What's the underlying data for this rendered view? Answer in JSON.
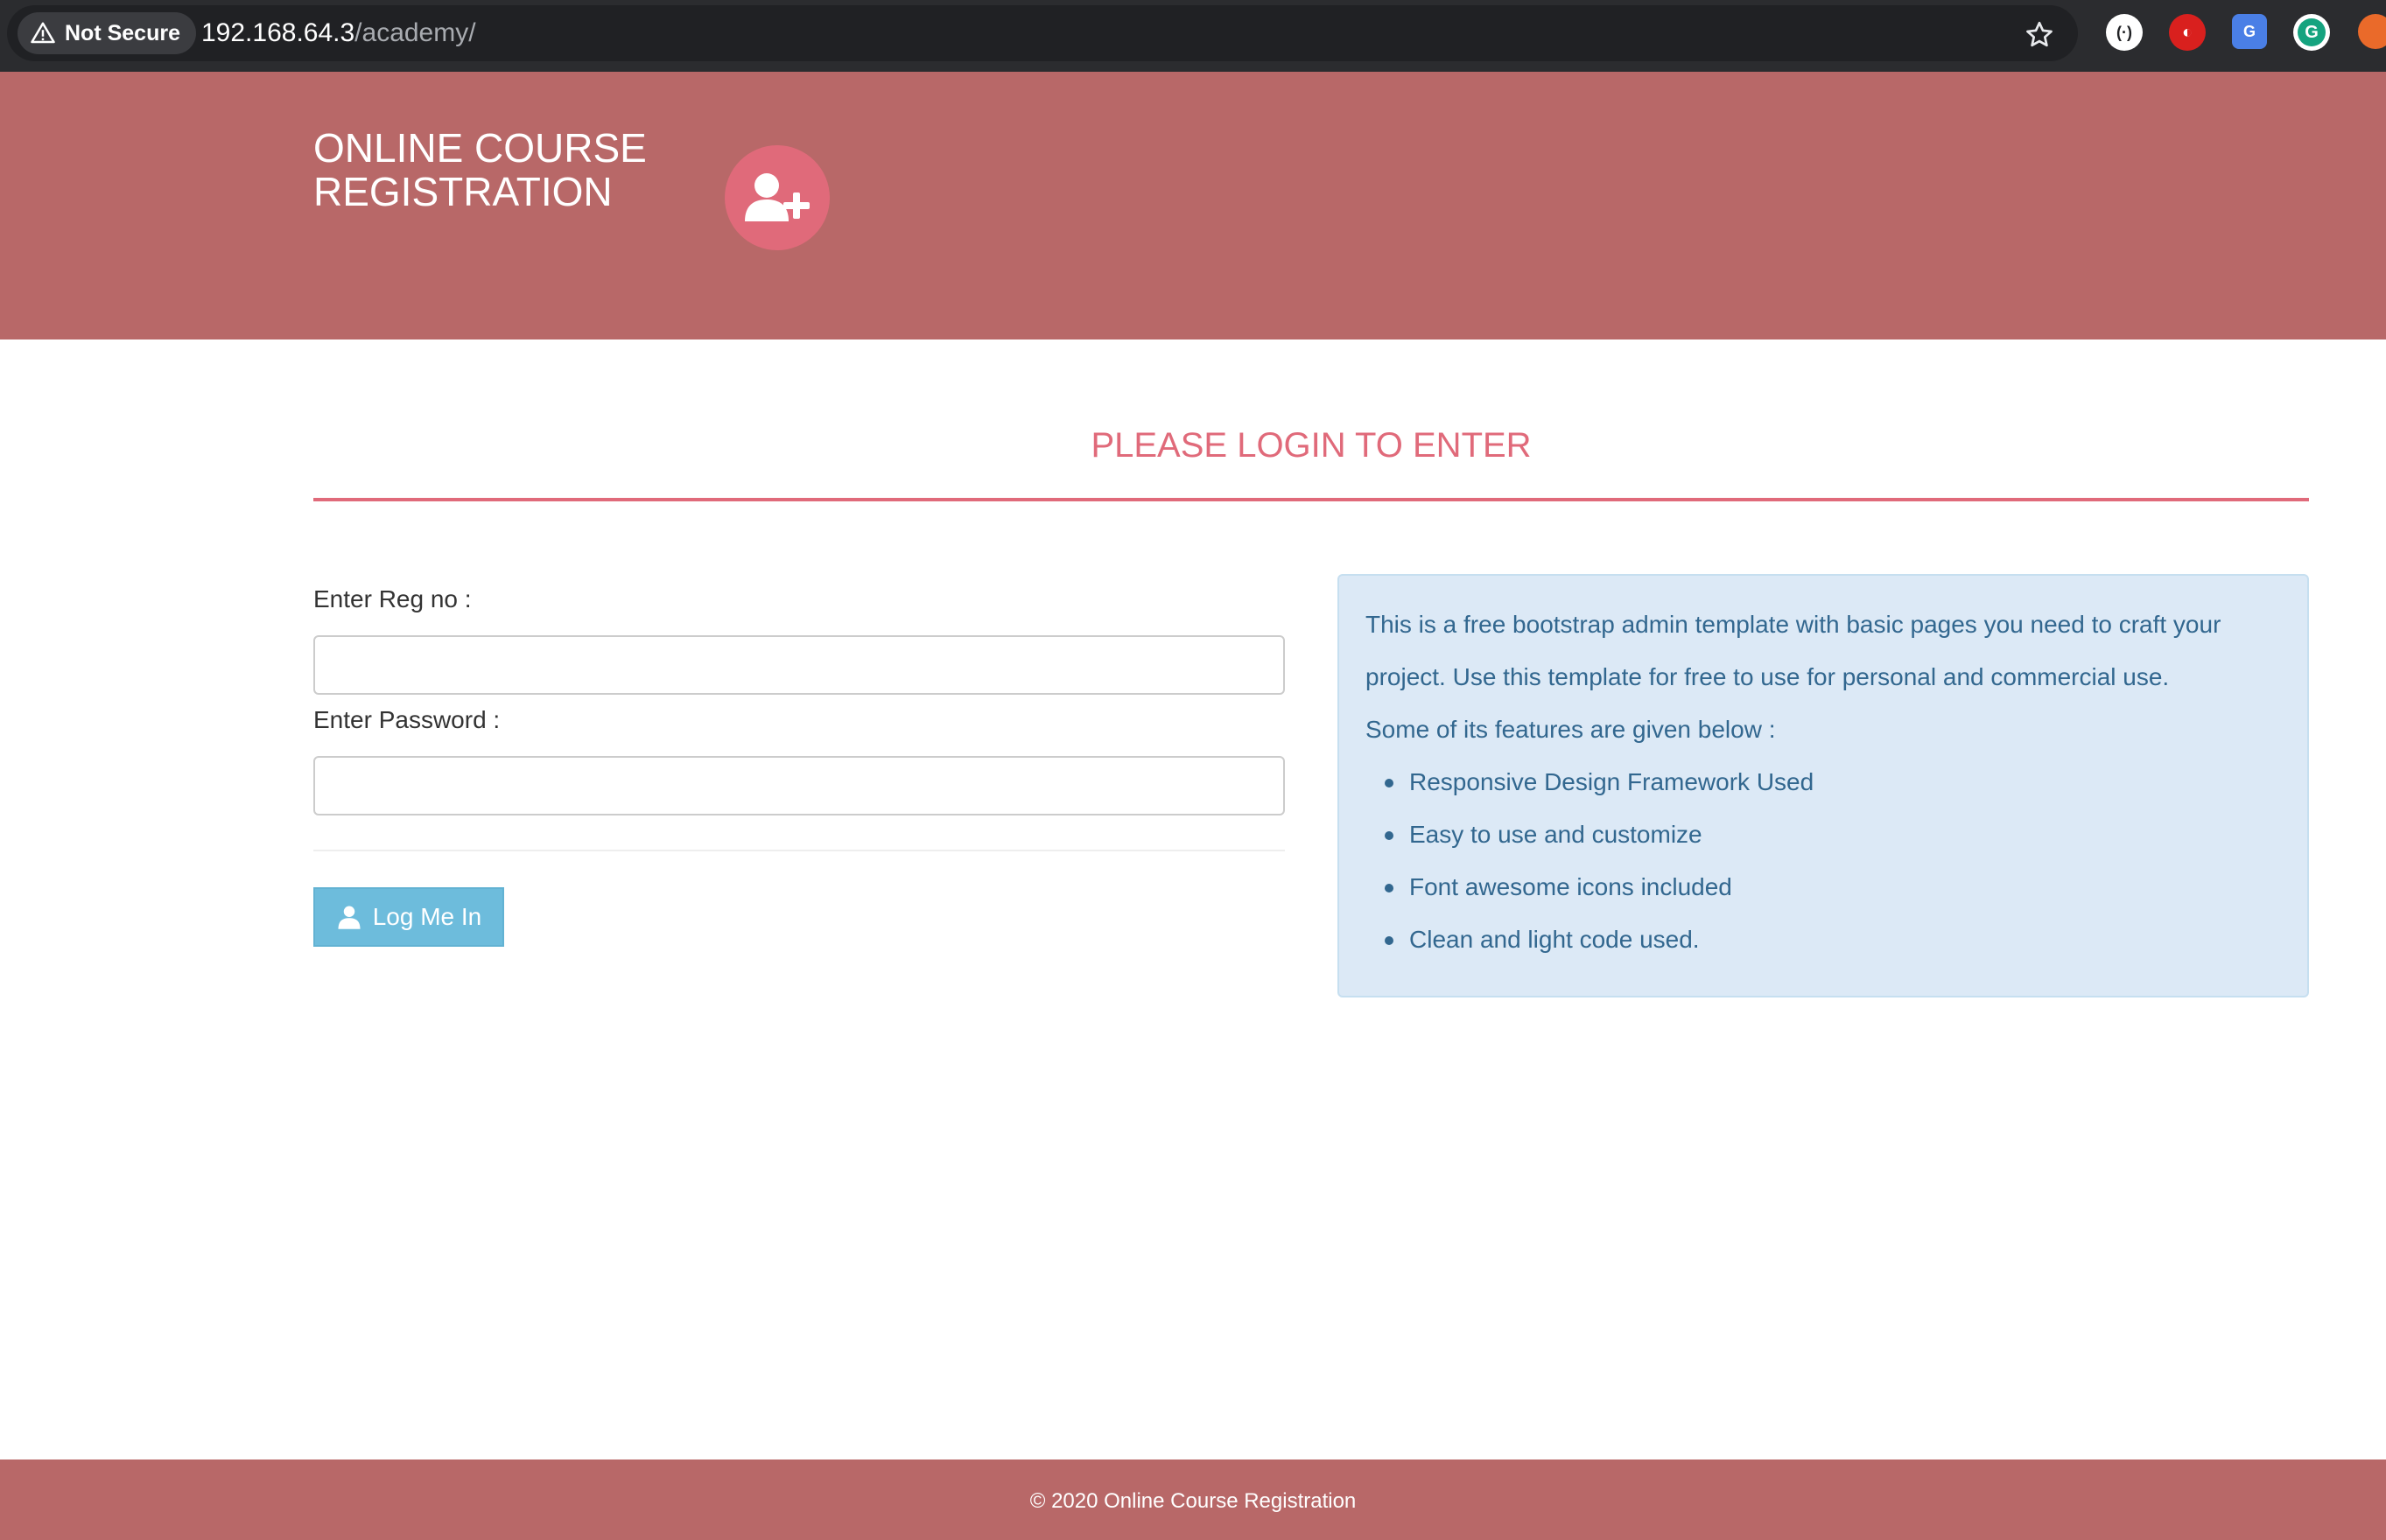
{
  "browser": {
    "security_label": "Not Secure",
    "url_host": "192.168.64.3",
    "url_path": "/academy/",
    "icons": [
      "warning-triangle-icon",
      "star-icon",
      "extension-icons"
    ]
  },
  "header": {
    "title": "ONLINE COURSE REGISTRATION",
    "logo_icon": "user-plus-icon"
  },
  "main": {
    "heading": "PLEASE LOGIN TO ENTER",
    "form": {
      "reg_label": "Enter Reg no :",
      "reg_value": "",
      "password_label": "Enter Password :",
      "password_value": "",
      "submit_label": "Log Me In",
      "submit_icon": "user-icon"
    },
    "info": {
      "intro": "This is a free bootstrap admin template with basic pages you need to craft your project. Use this template for free to use for personal and commercial use.",
      "features_heading": "Some of its features are given below :",
      "features": [
        "Responsive Design Framework Used",
        "Easy to use and customize",
        "Font awesome icons included",
        "Clean and light code used."
      ]
    }
  },
  "footer": {
    "text": "© 2020 Online Course Registration"
  },
  "colors": {
    "brand": "#b86868",
    "accent": "#e06a7a",
    "button": "#6dbcdc",
    "info_bg": "#dce9f6",
    "info_text": "#32678f"
  }
}
